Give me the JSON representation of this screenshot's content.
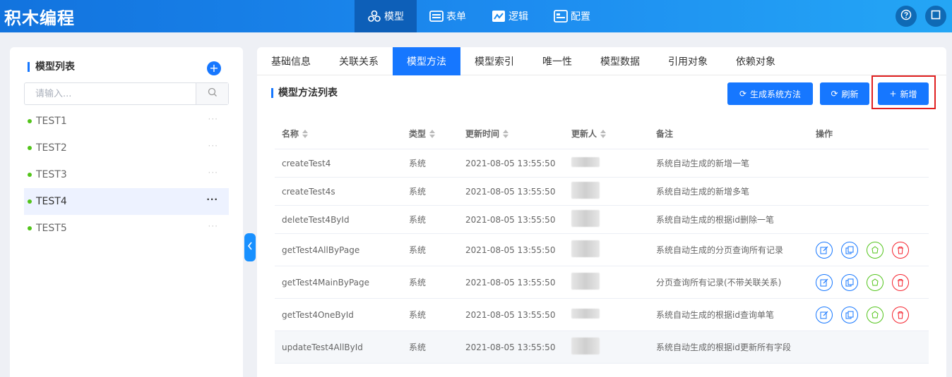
{
  "app": {
    "title": "积木编程"
  },
  "nav": [
    {
      "label": "模型",
      "icon": "cubes-icon",
      "active": true
    },
    {
      "label": "表单",
      "icon": "form-icon",
      "active": false
    },
    {
      "label": "逻辑",
      "icon": "logic-icon",
      "active": false
    },
    {
      "label": "配置",
      "icon": "config-icon",
      "active": false
    }
  ],
  "left": {
    "title": "模型列表",
    "search_placeholder": "请输入...",
    "items": [
      {
        "name": "TEST1",
        "more": "···"
      },
      {
        "name": "TEST2",
        "more": "···"
      },
      {
        "name": "TEST3",
        "more": "···"
      },
      {
        "name": "TEST4",
        "more": "···"
      },
      {
        "name": "TEST5",
        "more": "···"
      }
    ]
  },
  "tabs": [
    "基础信息",
    "关联关系",
    "模型方法",
    "模型索引",
    "唯一性",
    "模型数据",
    "引用对象",
    "依赖对象"
  ],
  "section": {
    "title": "模型方法列表",
    "generate_label": "生成系统方法",
    "refresh_label": "刷新",
    "add_label": "新增"
  },
  "table": {
    "headers": {
      "name": "名称",
      "type": "类型",
      "updated": "更新时间",
      "updater": "更新人",
      "remark": "备注",
      "ops": "操作"
    },
    "rows": [
      {
        "name": "createTest4",
        "type": "系统",
        "updated": "2021-08-05 13:55:50",
        "remark": "系统自动生成的新增一笔"
      },
      {
        "name": "createTest4s",
        "type": "系统",
        "updated": "2021-08-05 13:55:50",
        "remark": "系统自动生成的新增多笔"
      },
      {
        "name": "deleteTest4ById",
        "type": "系统",
        "updated": "2021-08-05 13:55:50",
        "remark": "系统自动生成的根据id删除一笔"
      },
      {
        "name": "getTest4AllByPage",
        "type": "系统",
        "updated": "2021-08-05 13:55:50",
        "remark": "系统自动生成的分页查询所有记录"
      },
      {
        "name": "getTest4MainByPage",
        "type": "系统",
        "updated": "2021-08-05 13:55:50",
        "remark": "分页查询所有记录(不带关联关系)"
      },
      {
        "name": "getTest4OneById",
        "type": "系统",
        "updated": "2021-08-05 13:55:50",
        "remark": "系统自动生成的根据id查询单笔"
      },
      {
        "name": "updateTest4AllById",
        "type": "系统",
        "updated": "2021-08-05 13:55:50",
        "remark": "系统自动生成的根据id更新所有字段"
      }
    ]
  },
  "colors": {
    "primary": "#1677ff",
    "header_active": "#0d5fb8",
    "success": "#52c41a",
    "danger": "#f5222d",
    "highlight": "#e02020"
  }
}
